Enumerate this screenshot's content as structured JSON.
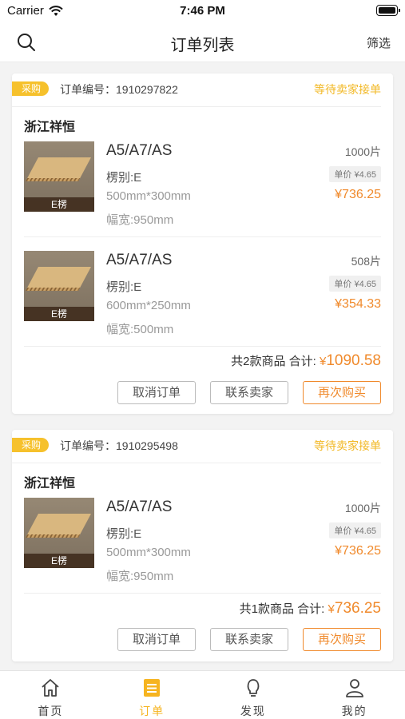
{
  "status_bar": {
    "carrier": "Carrier",
    "time": "7:46 PM"
  },
  "nav": {
    "title": "订单列表",
    "filter": "筛选"
  },
  "orders": [
    {
      "tag": "采购",
      "order_no": "订单编号：1910297822",
      "status": "等待卖家接单",
      "shop": "浙江祥恒",
      "items": [
        {
          "image_label": "E楞",
          "name": "A5/A7/AS",
          "flute": "楞别:E",
          "size": "500mm*300mm",
          "width": "幅宽:950mm",
          "qty": "1000片",
          "unit_price": "单价 ¥4.65",
          "subtotal": "¥736.25"
        },
        {
          "image_label": "E楞",
          "name": "A5/A7/AS",
          "flute": "楞别:E",
          "size": "600mm*250mm",
          "width": "幅宽:500mm",
          "qty": "508片",
          "unit_price": "单价 ¥4.65",
          "subtotal": "¥354.33"
        }
      ],
      "summary_prefix": "共2款商品  合计: ",
      "currency": "¥",
      "total": "1090.58",
      "buttons": {
        "cancel": "取消订单",
        "contact": "联系卖家",
        "rebuy": "再次购买"
      }
    },
    {
      "tag": "采购",
      "order_no": "订单编号：1910295498",
      "status": "等待卖家接单",
      "shop": "浙江祥恒",
      "items": [
        {
          "image_label": "E楞",
          "name": "A5/A7/AS",
          "flute": "楞别:E",
          "size": "500mm*300mm",
          "width": "幅宽:950mm",
          "qty": "1000片",
          "unit_price": "单价 ¥4.65",
          "subtotal": "¥736.25"
        }
      ],
      "summary_prefix": "共1款商品  合计: ",
      "currency": "¥",
      "total": "736.25",
      "buttons": {
        "cancel": "取消订单",
        "contact": "联系卖家",
        "rebuy": "再次购买"
      }
    }
  ],
  "tabs": [
    {
      "label": "首页",
      "icon": "home-icon"
    },
    {
      "label": "订单",
      "icon": "list-icon"
    },
    {
      "label": "发现",
      "icon": "lightbulb-icon"
    },
    {
      "label": "我的",
      "icon": "user-icon"
    }
  ],
  "colors": {
    "accent": "#f6b420",
    "price": "#f08a2c"
  }
}
